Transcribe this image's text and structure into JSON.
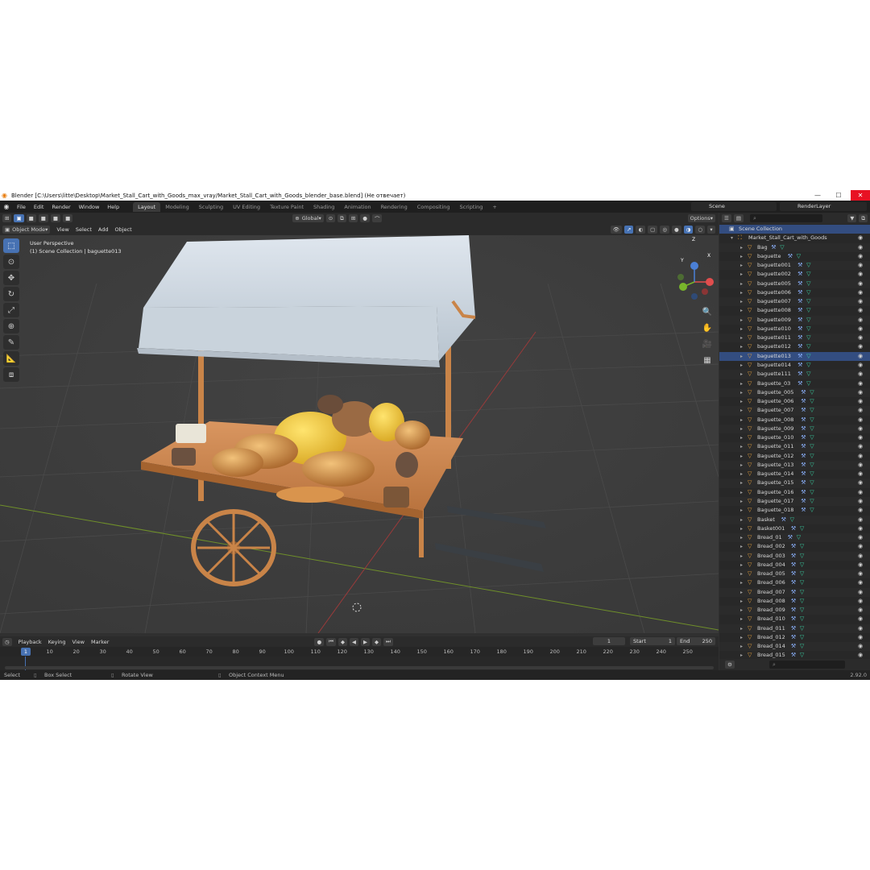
{
  "window": {
    "title": "Blender [C:\\Users\\litte\\Desktop\\Market_Stall_Cart_with_Goods_max_vray/Market_Stall_Cart_with_Goods_blender_base.blend] (Не отвечает)",
    "minimize": "—",
    "maximize": "☐",
    "close": "✕"
  },
  "menu": [
    "File",
    "Edit",
    "Render",
    "Window",
    "Help"
  ],
  "workspaces": [
    "Layout",
    "Modeling",
    "Sculpting",
    "UV Editing",
    "Texture Paint",
    "Shading",
    "Animation",
    "Rendering",
    "Compositing",
    "Scripting"
  ],
  "active_workspace": "Layout",
  "add_workspace": "+",
  "scene_name": "Scene",
  "view_layer": "RenderLayer",
  "header": {
    "mode": "Object Mode",
    "view": "View",
    "select": "Select",
    "add": "Add",
    "object": "Object",
    "orientation": "Global",
    "options": "Options"
  },
  "viewport": {
    "perspective": "User Perspective",
    "collection_info": "(1) Scene Collection | baguette013",
    "gizmo": {
      "x": "X",
      "y": "Y",
      "z": "Z"
    }
  },
  "timeline": {
    "playback": "Playback",
    "keying": "Keying",
    "view": "View",
    "marker": "Marker",
    "current_frame": "1",
    "start_label": "Start",
    "start": "1",
    "end_label": "End",
    "end": "250",
    "ticks": [
      "1",
      "10",
      "20",
      "30",
      "40",
      "50",
      "60",
      "70",
      "80",
      "90",
      "100",
      "110",
      "120",
      "130",
      "140",
      "150",
      "160",
      "170",
      "180",
      "190",
      "200",
      "210",
      "220",
      "230",
      "240",
      "250"
    ]
  },
  "status": {
    "select": "Select",
    "box_select": "Box Select",
    "rotate_view": "Rotate View",
    "context_menu": "Object Context Menu",
    "version": "2.92.0"
  },
  "outliner": {
    "root": "Scene Collection",
    "collection": "Market_Stall_Cart_with_Goods",
    "selected": "baguette013",
    "items": [
      "Bag",
      "baguette",
      "baguette001",
      "baguette002",
      "baguette005",
      "baguette006",
      "baguette007",
      "baguette008",
      "baguette009",
      "baguette010",
      "baguette011",
      "baguette012",
      "baguette013",
      "baguette014",
      "baguette111",
      "Baguette_03",
      "Baguette_005",
      "Baguette_006",
      "Baguette_007",
      "Baguette_008",
      "Baguette_009",
      "Baguette_010",
      "Baguette_011",
      "Baguette_012",
      "Baguette_013",
      "Baguette_014",
      "Baguette_015",
      "Baguette_016",
      "Baguette_017",
      "Baguette_018",
      "Basket",
      "Basket001",
      "Bread_01",
      "Bread_002",
      "Bread_003",
      "Bread_004",
      "Bread_005",
      "Bread_006",
      "Bread_007",
      "Bread_008",
      "Bread_009",
      "Bread_010",
      "Bread_011",
      "Bread_012",
      "Bread_014",
      "Bread_015"
    ]
  },
  "colors": {
    "accent": "#4772b3",
    "selection": "#334d80",
    "viewport_bg": "#3d3d3d",
    "close_red": "#e81123"
  }
}
